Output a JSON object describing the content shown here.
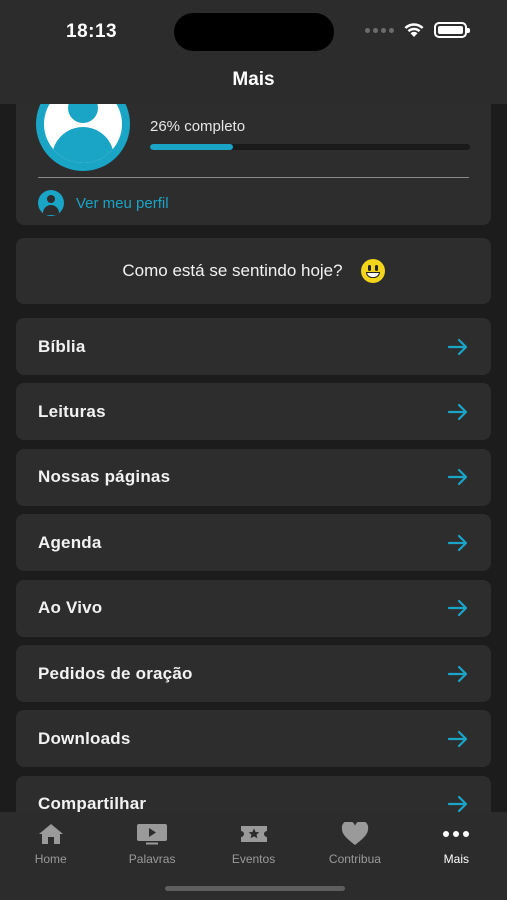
{
  "status": {
    "time": "18:13"
  },
  "header": {
    "title": "Mais"
  },
  "profile": {
    "progress_text": "26% completo",
    "progress": 0.26,
    "link_label": "Ver meu perfil"
  },
  "feeling": {
    "prompt": "Como está se sentindo hoje?"
  },
  "menu": [
    {
      "label": "Bíblia"
    },
    {
      "label": "Leituras"
    },
    {
      "label": "Nossas páginas"
    },
    {
      "label": "Agenda"
    },
    {
      "label": "Ao Vivo"
    },
    {
      "label": "Pedidos de oração"
    },
    {
      "label": "Downloads"
    },
    {
      "label": "Compartilhar"
    }
  ],
  "tabs": [
    {
      "label": "Home",
      "icon": "home-icon"
    },
    {
      "label": "Palavras",
      "icon": "play-tv-icon"
    },
    {
      "label": "Eventos",
      "icon": "ticket-icon"
    },
    {
      "label": "Contribua",
      "icon": "heart-icon"
    },
    {
      "label": "Mais",
      "icon": "more-dots-icon",
      "active": true
    }
  ],
  "colors": {
    "accent": "#1aa4c5",
    "card": "#2d2d2d",
    "background": "#1c1c1c",
    "bar": "#2c2c2c"
  }
}
